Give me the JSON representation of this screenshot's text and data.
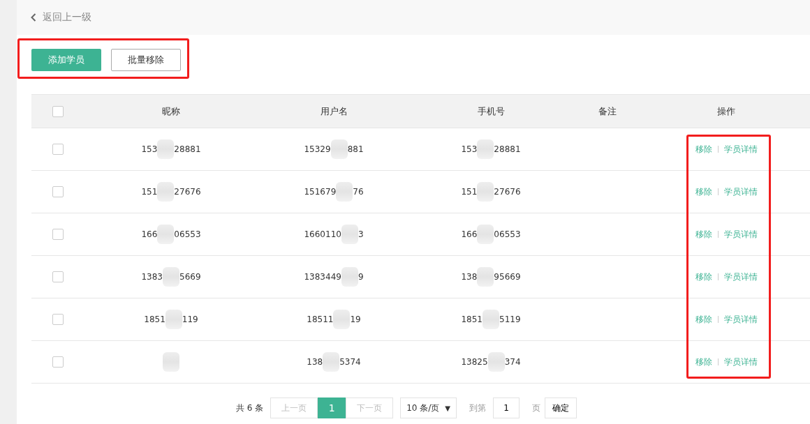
{
  "back_link": {
    "label": "返回上一级"
  },
  "toolbar": {
    "highlighted": true,
    "buttons": [
      {
        "label": "添加学员",
        "kind": "primary"
      },
      {
        "label": "批量移除",
        "kind": "default"
      }
    ]
  },
  "table": {
    "all_checked": false,
    "columns": [
      {
        "label": "昵称"
      },
      {
        "label": "用户名"
      },
      {
        "label": "手机号"
      },
      {
        "label": "备注"
      },
      {
        "label": "操作"
      }
    ],
    "actions_highlighted": true,
    "rows": [
      {
        "checked": false,
        "nickname": {
          "head": "153",
          "tail": "28881"
        },
        "username": {
          "head": "15329",
          "tail": "881"
        },
        "phone": {
          "head": "153",
          "tail": "28881"
        },
        "actions": [
          {
            "label": "移除"
          },
          {
            "label": "学员详情"
          }
        ]
      },
      {
        "checked": false,
        "nickname": {
          "head": "151",
          "tail": "27676"
        },
        "username": {
          "head": "151679",
          "tail": "76"
        },
        "phone": {
          "head": "151",
          "tail": "27676"
        },
        "actions": [
          {
            "label": "移除"
          },
          {
            "label": "学员详情"
          }
        ]
      },
      {
        "checked": false,
        "nickname": {
          "head": "166",
          "tail": "06553"
        },
        "username": {
          "head": "1660110",
          "tail": "3"
        },
        "phone": {
          "head": "166",
          "tail": "06553"
        },
        "actions": [
          {
            "label": "移除"
          },
          {
            "label": "学员详情"
          }
        ]
      },
      {
        "checked": false,
        "nickname": {
          "head": "1383",
          "tail": "5669"
        },
        "username": {
          "head": "1383449",
          "tail": "9"
        },
        "phone": {
          "head": "138",
          "tail": "95669"
        },
        "actions": [
          {
            "label": "移除"
          },
          {
            "label": "学员详情"
          }
        ]
      },
      {
        "checked": false,
        "nickname": {
          "head": "1851",
          "tail": "119"
        },
        "username": {
          "head": "18511",
          "tail": "19"
        },
        "phone": {
          "head": "1851",
          "tail": "5119"
        },
        "actions": [
          {
            "label": "移除"
          },
          {
            "label": "学员详情"
          }
        ]
      },
      {
        "checked": false,
        "nickname": {},
        "username": {
          "head": "138",
          "tail": "5374"
        },
        "phone": {
          "head": "13825",
          "tail": "374"
        },
        "actions": [
          {
            "label": "移除"
          },
          {
            "label": "学员详情"
          }
        ]
      }
    ]
  },
  "pagination": {
    "total": "共 6 条",
    "prev": "上一页",
    "pages": [
      {
        "label": "1",
        "selected": true
      }
    ],
    "next": "下一页",
    "page_size": "10 条/页",
    "size_caret": "▼",
    "goto_label": "到第",
    "goto_value": "1",
    "page_unit": "页",
    "confirm": "确定"
  }
}
